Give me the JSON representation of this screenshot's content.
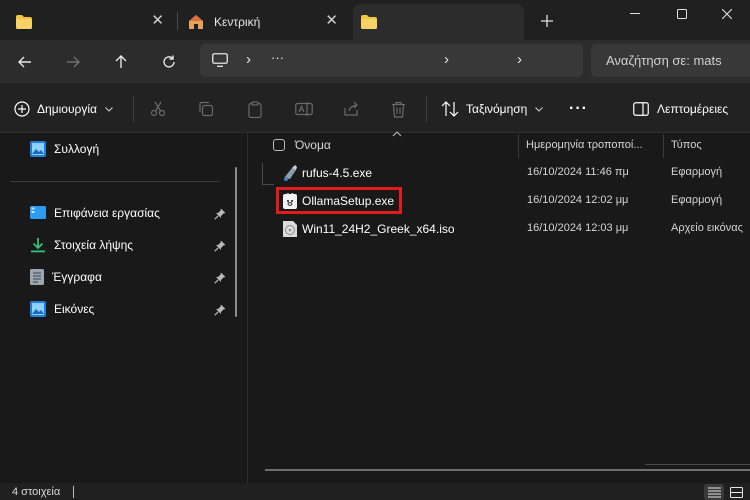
{
  "tabs": [
    {
      "label": "",
      "icon": "folder-icon"
    },
    {
      "label": "Κεντρική",
      "icon": "home-icon"
    },
    {
      "label": "",
      "icon": "folder-icon"
    }
  ],
  "address": {
    "path_separator": "›",
    "ellipsis": "···",
    "search_placeholder": "Αναζήτηση σε: mats"
  },
  "toolbar": {
    "new_label": "Δημιουργία",
    "sort_label": "Ταξινόμηση",
    "more_label": "···",
    "details_label": "Λεπτομέρειες"
  },
  "sidebar": {
    "items": [
      {
        "label": "Συλλογή",
        "icon": "gallery-icon",
        "pinned": false
      },
      {
        "label": "Επιφάνεια εργασίας",
        "icon": "desktop-icon",
        "pinned": true
      },
      {
        "label": "Στοιχεία λήψης",
        "icon": "download-icon",
        "pinned": true
      },
      {
        "label": "Έγγραφα",
        "icon": "documents-icon",
        "pinned": true
      },
      {
        "label": "Εικόνες",
        "icon": "pictures-icon",
        "pinned": true
      }
    ]
  },
  "filelist": {
    "columns": {
      "name": "Όνομα",
      "date": "Ημερομηνία τροποποί...",
      "type": "Τύπος"
    },
    "rows": [
      {
        "name": "rufus-4.5.exe",
        "date": "16/10/2024 11:46 πμ",
        "type": "Εφαρμογή",
        "icon": "rufus-app-icon"
      },
      {
        "name": "OllamaSetup.exe",
        "date": "16/10/2024 12:02 μμ",
        "type": "Εφαρμογή",
        "icon": "ollama-app-icon"
      },
      {
        "name": "Win11_24H2_Greek_x64.iso",
        "date": "16/10/2024 12:03 μμ",
        "type": "Αρχείο εικόνας",
        "icon": "disc-image-icon"
      }
    ]
  },
  "status": {
    "item_count": "4 στοιχεία"
  },
  "colors": {
    "accent": "#4cc2ff",
    "folder": "#f3c53f",
    "highlight": "#e21c1c"
  }
}
